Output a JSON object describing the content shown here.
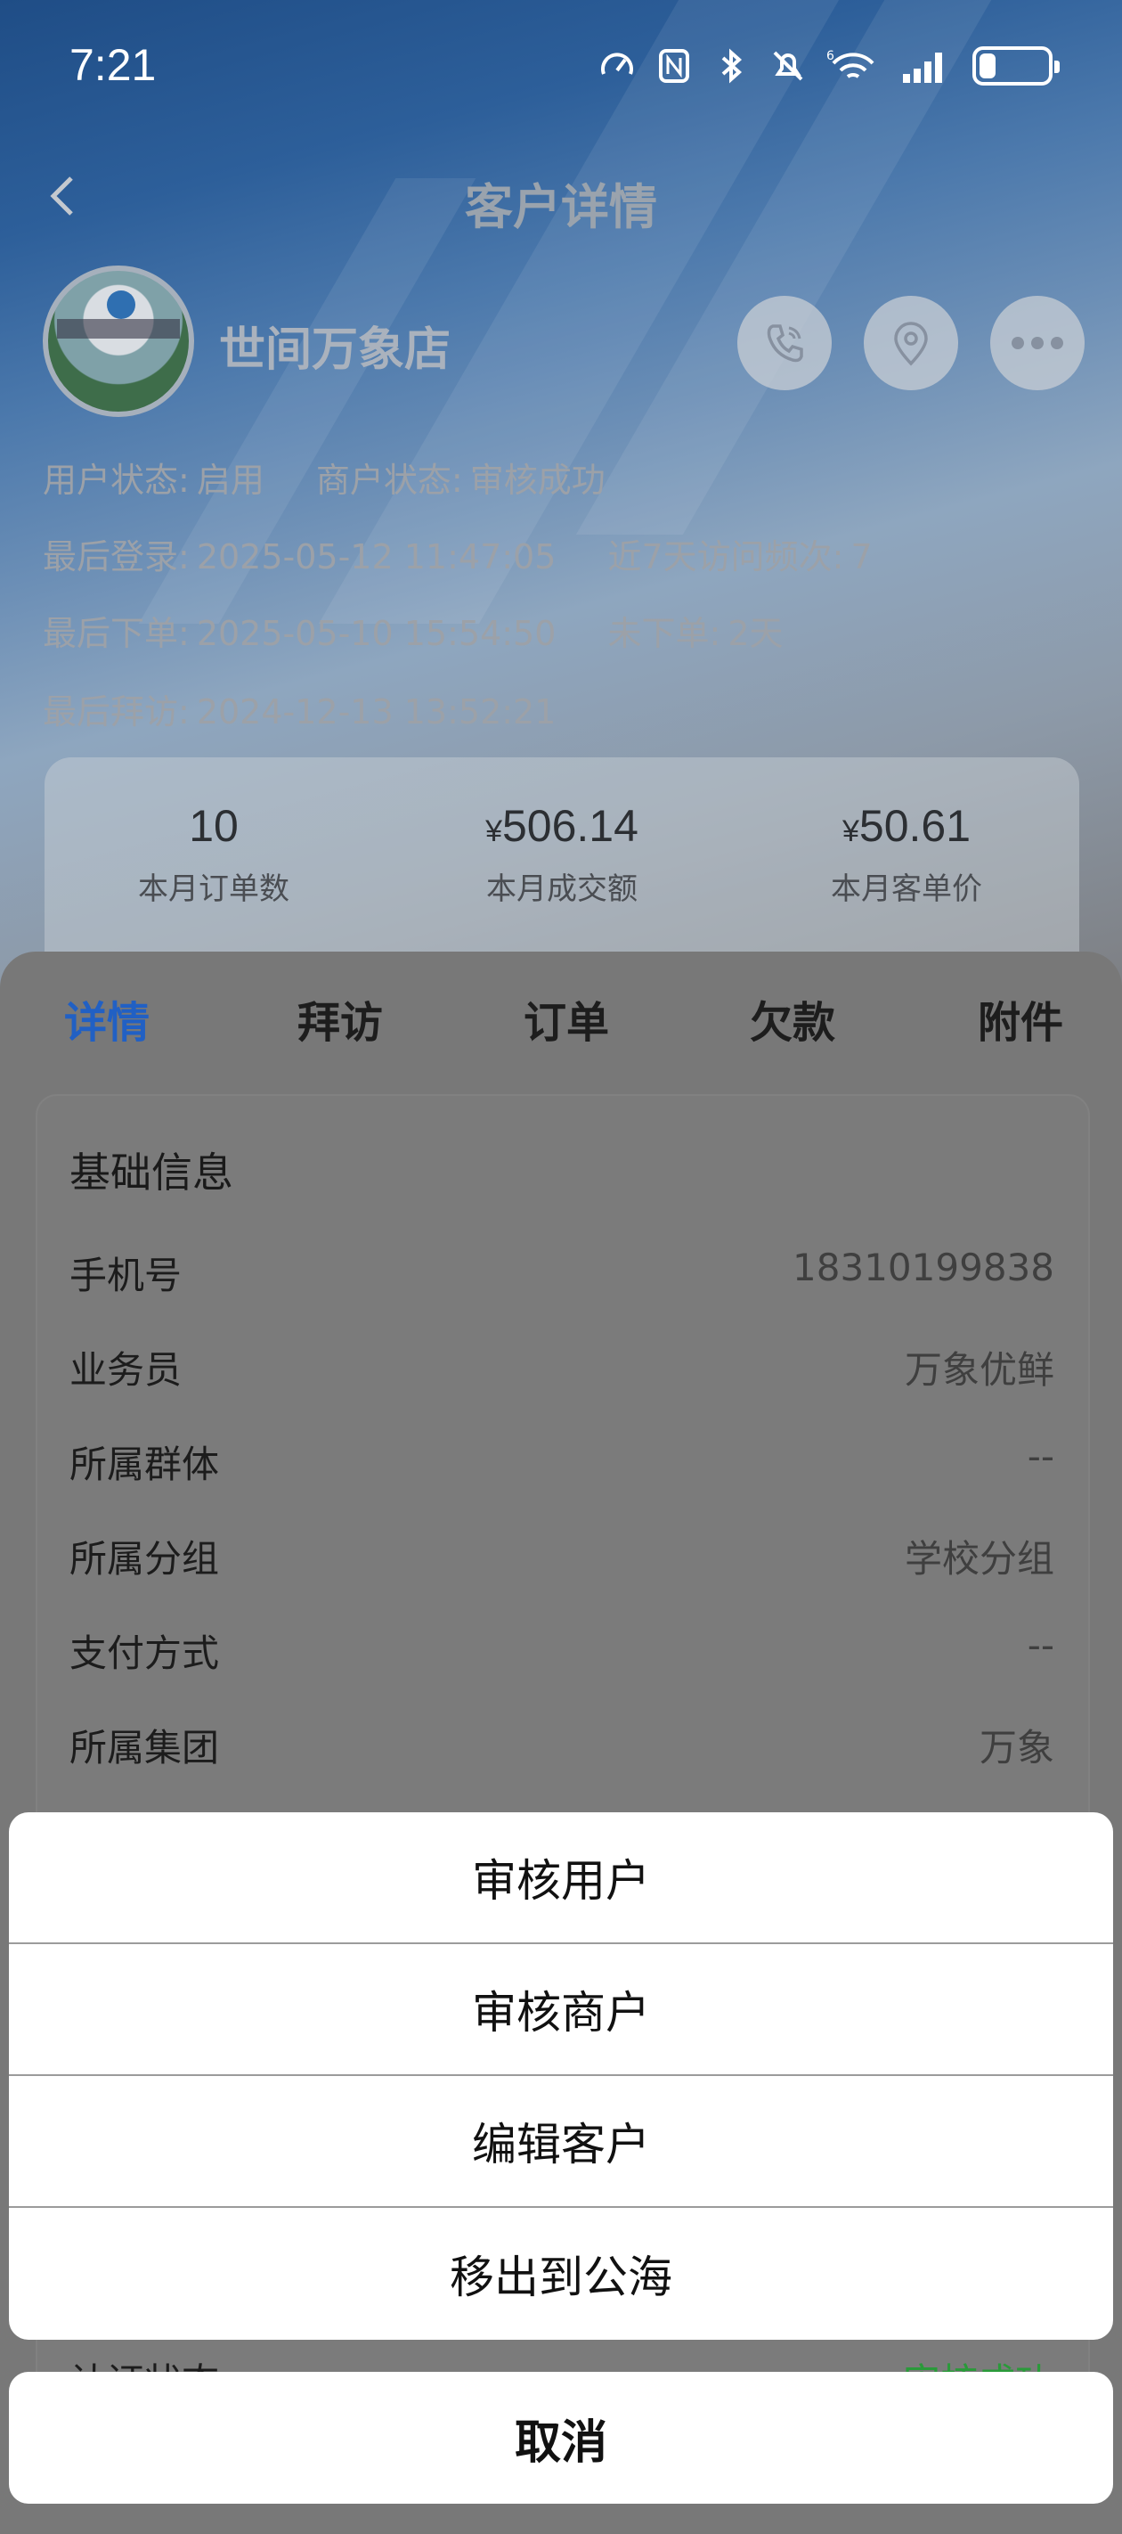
{
  "status_bar": {
    "time": "7:21",
    "signal_label": "6"
  },
  "nav": {
    "title": "客户详情"
  },
  "store": {
    "name": "世间万象店"
  },
  "info": {
    "user_status_label": "用户状态:",
    "user_status_value": "启用",
    "merchant_status_label": "商户状态:",
    "merchant_status_value": "审核成功",
    "last_login_label": "最后登录:",
    "last_login_value": "2025-05-12 11:47:05",
    "visit_freq_label": "近7天访问频次:",
    "visit_freq_value": "7",
    "last_order_label": "最后下单:",
    "last_order_value": "2025-05-10 15:54:50",
    "no_order_label": "未下单:",
    "no_order_value": "2天",
    "last_visit_label": "最后拜访:",
    "last_visit_value": "2024-12-13 13:52:21"
  },
  "stats": [
    {
      "currency": "",
      "value": "10",
      "label": "本月订单数"
    },
    {
      "currency": "¥",
      "value": "506.14",
      "label": "本月成交额"
    },
    {
      "currency": "¥",
      "value": "50.61",
      "label": "本月客单价"
    }
  ],
  "tabs": [
    "详情",
    "拜访",
    "订单",
    "欠款",
    "附件"
  ],
  "basic_info": {
    "title": "基础信息",
    "rows": [
      {
        "key": "手机号",
        "value": "18310199838"
      },
      {
        "key": "业务员",
        "value": "万象优鲜"
      },
      {
        "key": "所属群体",
        "value": "--"
      },
      {
        "key": "所属分组",
        "value": "学校分组"
      },
      {
        "key": "支付方式",
        "value": "--"
      },
      {
        "key": "所属集团",
        "value": "万象"
      }
    ],
    "peek_key": "认证状态",
    "peek_value": "审核成功"
  },
  "action_sheet": {
    "options": [
      "审核用户",
      "审核商户",
      "编辑客户",
      "移出到公海"
    ],
    "cancel": "取消"
  },
  "colors": {
    "tab_active": "#2160c4",
    "success": "#2a9a3a"
  }
}
